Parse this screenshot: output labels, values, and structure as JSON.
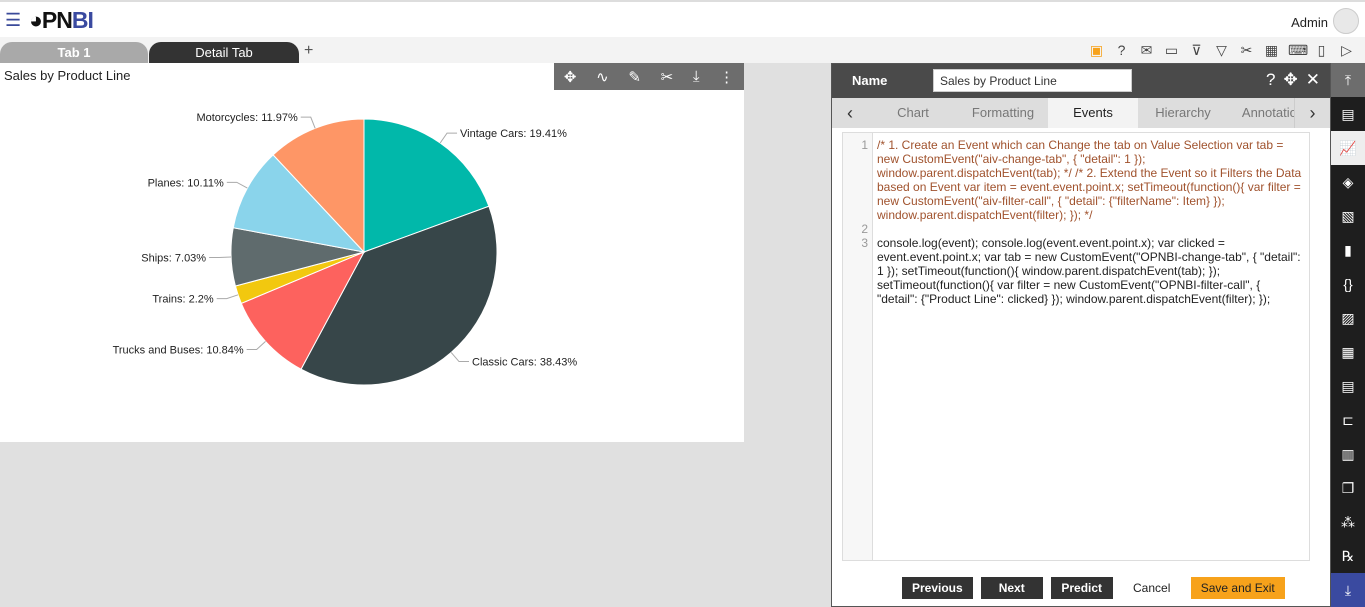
{
  "header": {
    "logo": "OPNBI",
    "user": "Admin"
  },
  "tabs": [
    {
      "label": "Tab 1"
    },
    {
      "label": "Detail Tab"
    }
  ],
  "toolbar_icons": [
    "save-icon",
    "help-icon",
    "mail-icon",
    "comment-icon",
    "clear-filter-icon",
    "filter-icon",
    "tools-icon",
    "table-icon",
    "embed-icon",
    "devices-icon",
    "play-icon"
  ],
  "chart_toolbar_icons": [
    "move-icon",
    "link-icon",
    "edit-icon",
    "settings-icon",
    "download-icon",
    "more-icon"
  ],
  "chart_data": {
    "type": "pie",
    "title": "Sales by Product Line",
    "slices": [
      {
        "label": "Vintage Cars",
        "value": 19.41,
        "color": "#01b8aa"
      },
      {
        "label": "Classic Cars",
        "value": 38.43,
        "color": "#374649"
      },
      {
        "label": "Trucks and Buses",
        "value": 10.84,
        "color": "#fd625e"
      },
      {
        "label": "Trains",
        "value": 2.2,
        "color": "#f2c80f"
      },
      {
        "label": "Ships",
        "value": 7.03,
        "color": "#5f6b6d"
      },
      {
        "label": "Planes",
        "value": 10.11,
        "color": "#8ad4eb"
      },
      {
        "label": "Motorcycles",
        "value": 11.97,
        "color": "#fe9666"
      }
    ]
  },
  "editor": {
    "name_label": "Name",
    "name_value": "Sales by Product Line",
    "tabs": [
      "Chart",
      "Formatting",
      "Events",
      "Hierarchy",
      "Annotation"
    ],
    "active_tab": "Events",
    "line_numbers": [
      "1",
      "2",
      "3"
    ],
    "comment": "/* 1. Create an Event which can Change the tab on Value Selection var tab = new CustomEvent(\"aiv-change-tab\", {    \"detail\": 1 }); window.parent.dispatchEvent(tab);  */ /* 2. Extend the Event so it Filters the Data based on Event var item = event.event.point.x; setTimeout(function(){ var filter = new CustomEvent(\"aiv-filter-call\", {    \"detail\": {\"filterName\": Item}  }); window.parent.dispatchEvent(filter); }); */",
    "code": "console.log(event); console.log(event.event.point.x); var clicked = event.event.point.x; var tab = new CustomEvent(\"OPNBI-change-tab\", { \"detail\": 1 }); setTimeout(function(){ window.parent.dispatchEvent(tab); }); setTimeout(function(){ var filter = new CustomEvent(\"OPNBI-filter-call\", { \"detail\": {\"Product Line\": clicked} }); window.parent.dispatchEvent(filter); });",
    "buttons": {
      "previous": "Previous",
      "next": "Next",
      "predict": "Predict",
      "cancel": "Cancel",
      "save": "Save and Exit"
    }
  }
}
